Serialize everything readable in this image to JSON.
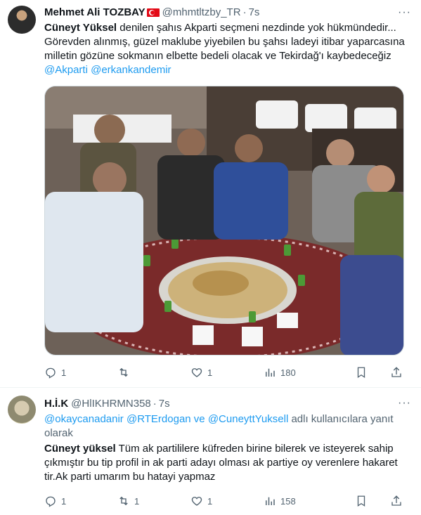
{
  "tweets": [
    {
      "author": {
        "name": "Mehmet Ali TOZBAY",
        "handle": "@mhmtltzby_TR",
        "time": "7s"
      },
      "text": {
        "bold": "Cüneyt Yüksel",
        "part1": " denilen şahıs Akparti seçmeni nezdinde yok hükmündedir... Görevden alınmış, güzel  maklube yiyebilen bu şahsı ladeyi itibar yaparcasına milletin gözüne sokmanın elbette bedeli olacak ve Tekirdağ'ı kaybedeceğiz ",
        "mention1": "@Akparti",
        "mention2": "@erkankandemir"
      },
      "stats": {
        "replies": "1",
        "retweets": "",
        "likes": "1",
        "views": "180"
      }
    },
    {
      "author": {
        "name": "H.İ.K",
        "handle": "@HlIKHRMN358",
        "time": "7s"
      },
      "reply_to": {
        "mention1": "@okaycanadanir",
        "mention2": "@RTErdogan",
        "connector": " ve ",
        "mention3": "@CuneyttYuksell",
        "suffix": " adlı kullanıcılara yanıt olarak"
      },
      "text": {
        "bold": "Cüneyt yüksel",
        "part1": " Tüm ak partililere küfreden birine bilerek ve isteyerek sahip çıkmıştır bu tip profil in ak parti adayı olması ak partiye oy verenlere hakaret tir.Ak parti umarım bu hatayi yapmaz"
      },
      "stats": {
        "replies": "1",
        "retweets": "1",
        "likes": "1",
        "views": "158"
      }
    }
  ],
  "icons": [
    "more-icon",
    "reply-icon",
    "retweet-icon",
    "like-icon",
    "views-icon",
    "bookmark-icon",
    "share-icon"
  ],
  "colors": {
    "link": "#1d9bf0",
    "muted": "#536471",
    "text": "#0f1419",
    "flag": "#e30a17"
  }
}
